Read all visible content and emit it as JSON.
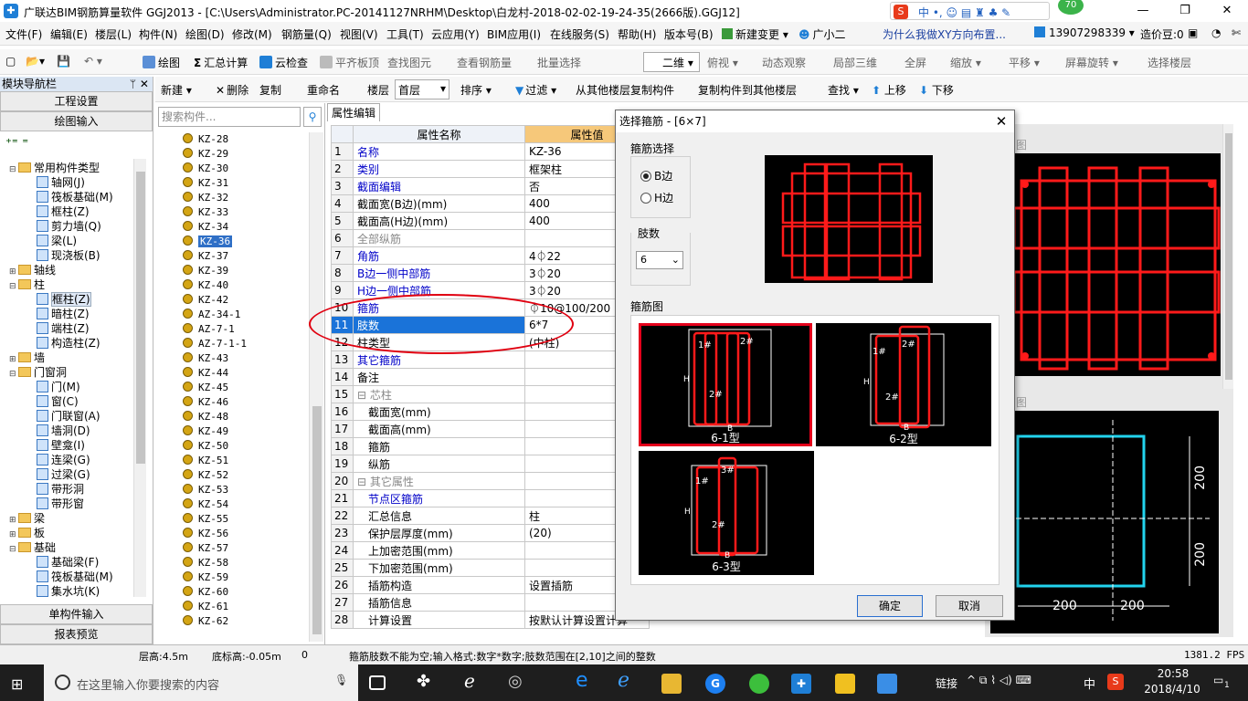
{
  "window": {
    "title": "广联达BIM钢筋算量软件 GGJ2013 - [C:\\Users\\Administrator.PC-20141127NRHM\\Desktop\\白龙村-2018-02-02-19-24-35(2666版).GGJ12]",
    "minimize": "—",
    "maximize": "❐",
    "close": "✕",
    "badge": "70"
  },
  "menu": [
    "文件(F)",
    "编辑(E)",
    "楼层(L)",
    "构件(N)",
    "绘图(D)",
    "修改(M)",
    "钢筋量(Q)",
    "视图(V)",
    "工具(T)",
    "云应用(Y)",
    "BIM应用(I)",
    "在线服务(S)",
    "帮助(H)",
    "版本号(B)",
    "新建变更 ▾",
    "广小二"
  ],
  "menu_right": {
    "link": "为什么我做XY方向布置...",
    "phone": "13907298339 ▾",
    "beans": "造价豆:0"
  },
  "toolbar1": {
    "draw": "绘图",
    "sum": "汇总计算",
    "cloud_check": "云检查",
    "flat_board": "平齐板顶",
    "find_elem": "查找图元",
    "view_rebar": "查看钢筋量",
    "batch_select": "批量选择",
    "view_mode": "二维",
    "topview": "俯视",
    "dyn_view": "动态观察",
    "local3d": "局部三维",
    "fullscreen": "全屏",
    "zoom": "缩放",
    "pan": "平移",
    "rotate": "屏幕旋转",
    "select_floor": "选择楼层"
  },
  "toolbar2": {
    "new": "新建",
    "delete": "删除",
    "copy": "复制",
    "rename": "重命名",
    "floor_label": "楼层",
    "floor_value": "首层",
    "sort": "排序",
    "filter": "过滤",
    "copy_from": "从其他楼层复制构件",
    "copy_to": "复制构件到其他楼层",
    "find": "查找",
    "up": "上移",
    "down": "下移"
  },
  "leftpanel": {
    "header": "模块导航栏",
    "pin": "ᛘ ✕",
    "btn_project": "工程设置",
    "btn_draw": "绘图输入",
    "tree": [
      {
        "label": "常用构件类型",
        "kind": "folder",
        "exp": "⊟",
        "level": 0
      },
      {
        "label": "轴网(J)",
        "kind": "comp",
        "level": 1
      },
      {
        "label": "筏板基础(M)",
        "kind": "comp",
        "level": 1
      },
      {
        "label": "框柱(Z)",
        "kind": "comp",
        "level": 1
      },
      {
        "label": "剪力墙(Q)",
        "kind": "comp",
        "level": 1
      },
      {
        "label": "梁(L)",
        "kind": "comp",
        "level": 1
      },
      {
        "label": "现浇板(B)",
        "kind": "comp",
        "level": 1
      },
      {
        "label": "轴线",
        "kind": "folder",
        "exp": "⊞",
        "level": 0
      },
      {
        "label": "柱",
        "kind": "folder",
        "exp": "⊟",
        "level": 0
      },
      {
        "label": "框柱(Z)",
        "kind": "comp",
        "level": 1,
        "sel": true
      },
      {
        "label": "暗柱(Z)",
        "kind": "comp",
        "level": 1
      },
      {
        "label": "端柱(Z)",
        "kind": "comp",
        "level": 1
      },
      {
        "label": "构造柱(Z)",
        "kind": "comp",
        "level": 1
      },
      {
        "label": "墙",
        "kind": "folder",
        "exp": "⊞",
        "level": 0
      },
      {
        "label": "门窗洞",
        "kind": "folder",
        "exp": "⊟",
        "level": 0
      },
      {
        "label": "门(M)",
        "kind": "comp",
        "level": 1
      },
      {
        "label": "窗(C)",
        "kind": "comp",
        "level": 1
      },
      {
        "label": "门联窗(A)",
        "kind": "comp",
        "level": 1
      },
      {
        "label": "墙洞(D)",
        "kind": "comp",
        "level": 1
      },
      {
        "label": "壁龛(I)",
        "kind": "comp",
        "level": 1
      },
      {
        "label": "连梁(G)",
        "kind": "comp",
        "level": 1
      },
      {
        "label": "过梁(G)",
        "kind": "comp",
        "level": 1
      },
      {
        "label": "带形洞",
        "kind": "comp",
        "level": 1
      },
      {
        "label": "带形窗",
        "kind": "comp",
        "level": 1
      },
      {
        "label": "梁",
        "kind": "folder",
        "exp": "⊞",
        "level": 0
      },
      {
        "label": "板",
        "kind": "folder",
        "exp": "⊞",
        "level": 0
      },
      {
        "label": "基础",
        "kind": "folder",
        "exp": "⊟",
        "level": 0
      },
      {
        "label": "基础梁(F)",
        "kind": "comp",
        "level": 1
      },
      {
        "label": "筏板基础(M)",
        "kind": "comp",
        "level": 1
      },
      {
        "label": "集水坑(K)",
        "kind": "comp",
        "level": 1
      }
    ],
    "btn_single": "单构件输入",
    "btn_report": "报表预览"
  },
  "midpanel": {
    "search_placeholder": "搜索构件...",
    "items": [
      "KZ-28",
      "KZ-29",
      "KZ-30",
      "KZ-31",
      "KZ-32",
      "KZ-33",
      "KZ-34",
      "KZ-36",
      "KZ-37",
      "KZ-39",
      "KZ-40",
      "KZ-42",
      "AZ-34-1",
      "AZ-7-1",
      "AZ-7-1-1",
      "KZ-43",
      "KZ-44",
      "KZ-45",
      "KZ-46",
      "KZ-48",
      "KZ-49",
      "KZ-50",
      "KZ-51",
      "KZ-52",
      "KZ-53",
      "KZ-54",
      "KZ-55",
      "KZ-56",
      "KZ-57",
      "KZ-58",
      "KZ-59",
      "KZ-60",
      "KZ-61",
      "KZ-62"
    ],
    "selected": "KZ-36"
  },
  "props": {
    "tab": "属性编辑",
    "col_name": "属性名称",
    "col_value": "属性值",
    "rows": [
      {
        "n": "1",
        "name": "名称",
        "value": "KZ-36",
        "cls": "blue"
      },
      {
        "n": "2",
        "name": "类别",
        "value": "框架柱",
        "cls": "blue"
      },
      {
        "n": "3",
        "name": "截面编辑",
        "value": "否",
        "cls": "blue"
      },
      {
        "n": "4",
        "name": "截面宽(B边)(mm)",
        "value": "400",
        "cls": ""
      },
      {
        "n": "5",
        "name": "截面高(H边)(mm)",
        "value": "400",
        "cls": ""
      },
      {
        "n": "6",
        "name": "全部纵筋",
        "value": "",
        "cls": "gtxt"
      },
      {
        "n": "7",
        "name": "角筋",
        "value": "4⏀22",
        "cls": "blue"
      },
      {
        "n": "8",
        "name": "B边一侧中部筋",
        "value": "3⏀20",
        "cls": "blue"
      },
      {
        "n": "9",
        "name": "H边一侧中部筋",
        "value": "3⏀20",
        "cls": "blue"
      },
      {
        "n": "10",
        "name": "箍筋",
        "value": "⏀10@100/200",
        "cls": "blue"
      },
      {
        "n": "11",
        "name": "肢数",
        "value": "6*7",
        "cls": "",
        "sel": true
      },
      {
        "n": "12",
        "name": "柱类型",
        "value": "(中柱)",
        "cls": ""
      },
      {
        "n": "13",
        "name": "其它箍筋",
        "value": "",
        "cls": "blue"
      },
      {
        "n": "14",
        "name": "备注",
        "value": "",
        "cls": ""
      },
      {
        "n": "15",
        "name": "⊟ 芯柱",
        "value": "",
        "cls": "gtxt"
      },
      {
        "n": "16",
        "name": "　截面宽(mm)",
        "value": "",
        "cls": ""
      },
      {
        "n": "17",
        "name": "　截面高(mm)",
        "value": "",
        "cls": ""
      },
      {
        "n": "18",
        "name": "　箍筋",
        "value": "",
        "cls": ""
      },
      {
        "n": "19",
        "name": "　纵筋",
        "value": "",
        "cls": ""
      },
      {
        "n": "20",
        "name": "⊟ 其它属性",
        "value": "",
        "cls": "gtxt"
      },
      {
        "n": "21",
        "name": "　节点区箍筋",
        "value": "",
        "cls": "blue"
      },
      {
        "n": "22",
        "name": "　汇总信息",
        "value": "柱",
        "cls": ""
      },
      {
        "n": "23",
        "name": "　保护层厚度(mm)",
        "value": "(20)",
        "cls": ""
      },
      {
        "n": "24",
        "name": "　上加密范围(mm)",
        "value": "",
        "cls": ""
      },
      {
        "n": "25",
        "name": "　下加密范围(mm)",
        "value": "",
        "cls": ""
      },
      {
        "n": "26",
        "name": "　插筋构造",
        "value": "设置插筋",
        "cls": ""
      },
      {
        "n": "27",
        "name": "　插筋信息",
        "value": "",
        "cls": ""
      },
      {
        "n": "28",
        "name": "　计算设置",
        "value": "按默认计算设置计算",
        "cls": ""
      }
    ]
  },
  "dialog": {
    "title": "选择箍筋 - [6×7]",
    "close": "✕",
    "group1": "箍筋选择",
    "radio_b": "B边",
    "radio_h": "H边",
    "legs_label": "肢数",
    "legs_value": "6",
    "group2": "箍筋图",
    "styles": [
      "6-1型",
      "6-2型",
      "6-3型"
    ],
    "tag1": "1#",
    "tag2": "2#",
    "tag3": "3#",
    "b_mark": "B",
    "h_mark": "H",
    "ok": "确定",
    "cancel": "取消"
  },
  "rightpanel": {
    "dim1": "200",
    "dim2": "200",
    "dim3": "200",
    "dim4": "200",
    "label_a": "图",
    "label_b": "图"
  },
  "status": {
    "floor_h": "层高:4.5m",
    "bottom_h": "底标高:-0.05m",
    "zero": "0",
    "message": "箍筋肢数不能为空;输入格式:数字*数字;肢数范围在[2,10]之间的整数",
    "fps": "1381.2 FPS"
  },
  "taskbar": {
    "search": "在这里输入你要搜索的内容",
    "link": "链接",
    "ime": "中",
    "time": "20:58",
    "date": "2018/4/10",
    "notif": "1"
  },
  "colors": {
    "accent": "#1f7fd6",
    "rebar": "#ff1a1a",
    "select": "#e4001b",
    "cyan": "#22d3ee"
  }
}
